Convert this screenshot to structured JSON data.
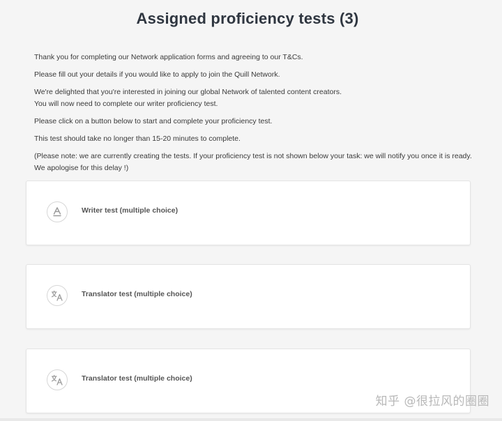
{
  "page": {
    "title": "Assigned proficiency tests (3)"
  },
  "intro": {
    "line1": "Thank you for completing our Network application forms and agreeing to our T&Cs.",
    "line2": "Please fill out your details if you would like to apply to join the Quill Network.",
    "line3a": "We're delighted that you're interested in joining our global Network of talented content creators.",
    "line3b": "You will now need to complete our writer proficiency test.",
    "line4": "Please click on a button below to start and complete your proficiency test.",
    "line5": "This test should take no longer than 15-20 minutes to complete.",
    "line6": "(Please note: we are currently creating the tests. If your proficiency test is not shown below your task: we will notify you once it is ready. We apologise for this delay !)"
  },
  "tests": [
    {
      "label": "Writer test (multiple choice)",
      "icon": "writer-icon"
    },
    {
      "label": "Translator test (multiple choice)",
      "icon": "translate-icon"
    },
    {
      "label": "Translator test (multiple choice)",
      "icon": "translate-icon"
    }
  ],
  "watermark": "知乎 @很拉风的圈圈"
}
